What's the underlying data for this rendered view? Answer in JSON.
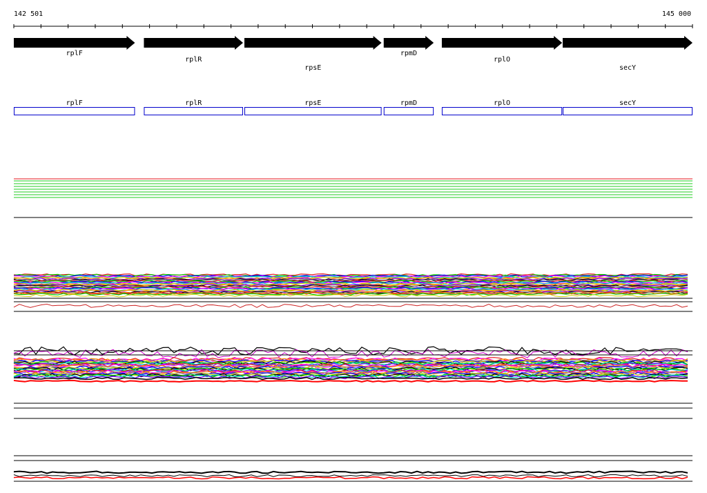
{
  "axis": {
    "start_label": "142 501",
    "end_label": "145 000"
  },
  "genes": [
    {
      "name": "rplF",
      "start": 142501,
      "end": 142947,
      "label_row": 0
    },
    {
      "name": "rplR",
      "start": 142980,
      "end": 143345,
      "label_row": 1
    },
    {
      "name": "rpsE",
      "start": 143350,
      "end": 143855,
      "label_row": 2
    },
    {
      "name": "rpmD",
      "start": 143863,
      "end": 144047,
      "label_row": 0
    },
    {
      "name": "rplO",
      "start": 144077,
      "end": 144520,
      "label_row": 1
    },
    {
      "name": "secY",
      "start": 144522,
      "end": 145000,
      "label_row": 2
    }
  ],
  "track_colors": [
    "#e41a1c",
    "#00cc00",
    "#0000ff",
    "#ff00ff",
    "#00cccc",
    "#cccc00",
    "#ff8800",
    "#8800ff",
    "#000000",
    "#888888"
  ]
}
